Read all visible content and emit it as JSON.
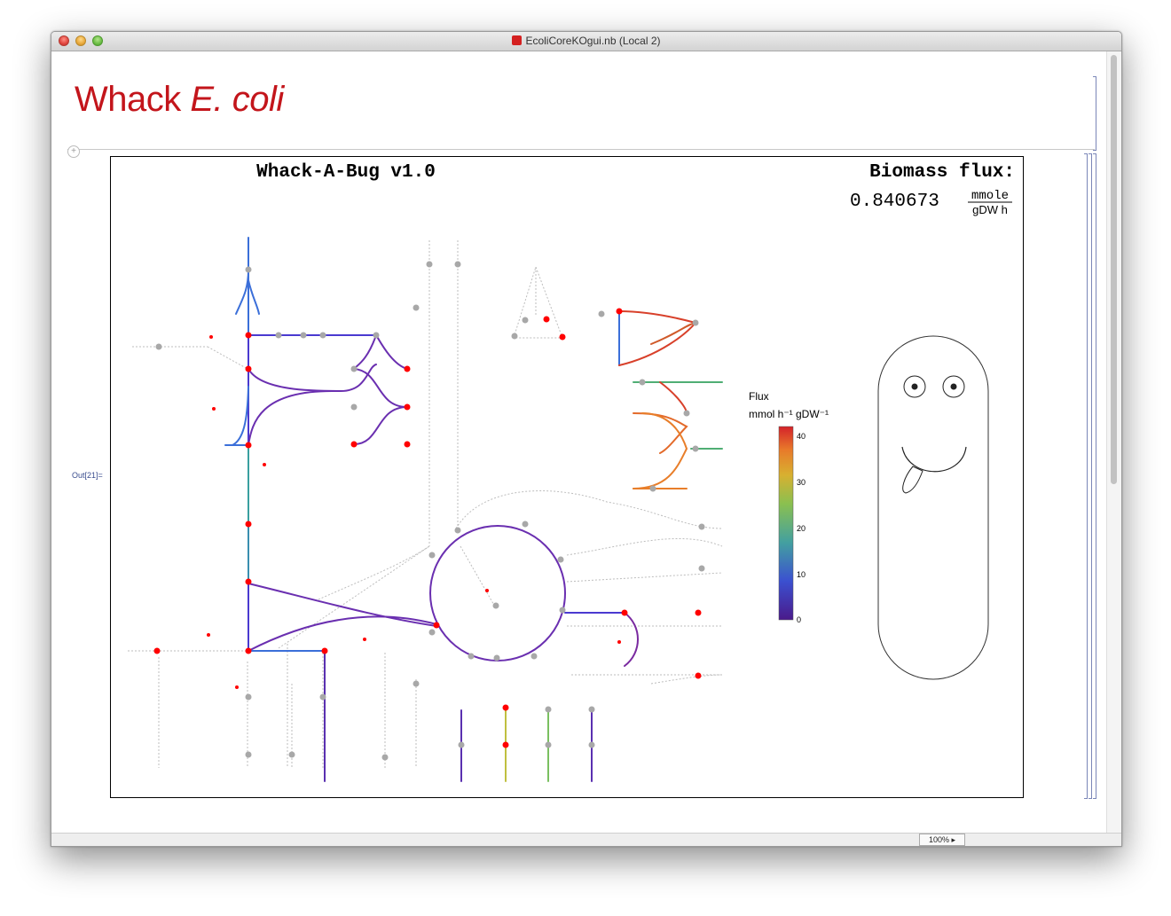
{
  "window": {
    "title": "EcoliCoreKOgui.nb (Local 2)"
  },
  "notebook": {
    "title_plain": "Whack ",
    "title_italic": "E. coli",
    "output_label": "Out[21]=",
    "zoom": "100%"
  },
  "graphic": {
    "heading": "Whack-A-Bug v1.0",
    "biomass_label": "Biomass flux:",
    "biomass_value": "0.840673",
    "units_numerator": "mmole",
    "units_denominator": "gDW h"
  },
  "legend": {
    "title": "Flux",
    "units": "mmol h⁻¹ gDW⁻¹",
    "ticks": [
      "40",
      "30",
      "20",
      "10",
      "0"
    ]
  },
  "colors": {
    "title_red": "#c3151b",
    "node_red": "#ff0000",
    "node_gray": "#a8a8a8"
  }
}
